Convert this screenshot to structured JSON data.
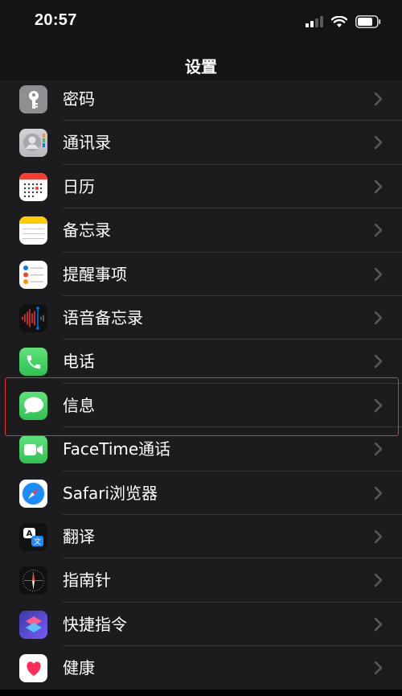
{
  "status_bar": {
    "time": "20:57"
  },
  "nav": {
    "title": "设置"
  },
  "rows": [
    {
      "label": "密码",
      "icon": "key-icon",
      "color": "#8e8e93"
    },
    {
      "label": "通讯录",
      "icon": "contacts-icon",
      "color": "#c7c7cc"
    },
    {
      "label": "日历",
      "icon": "calendar-icon",
      "color": "#ffffff"
    },
    {
      "label": "备忘录",
      "icon": "notes-icon",
      "color": "#ffffff"
    },
    {
      "label": "提醒事项",
      "icon": "reminders-icon",
      "color": "#ffffff"
    },
    {
      "label": "语音备忘录",
      "icon": "voice-memos-icon",
      "color": "#1c1c1e"
    },
    {
      "label": "电话",
      "icon": "phone-icon",
      "color": "#34c759"
    },
    {
      "label": "信息",
      "icon": "messages-icon",
      "color": "#34c759"
    },
    {
      "label": "FaceTime通话",
      "icon": "facetime-icon",
      "color": "#34c759"
    },
    {
      "label": "Safari浏览器",
      "icon": "safari-icon",
      "color": "#ffffff"
    },
    {
      "label": "翻译",
      "icon": "translate-icon",
      "color": "#1c1c1e"
    },
    {
      "label": "指南针",
      "icon": "compass-icon",
      "color": "#1c1c1e"
    },
    {
      "label": "快捷指令",
      "icon": "shortcuts-icon",
      "color": "#5e5ce6"
    },
    {
      "label": "健康",
      "icon": "health-icon",
      "color": "#ffffff"
    }
  ],
  "highlight_color": "#e5332a"
}
